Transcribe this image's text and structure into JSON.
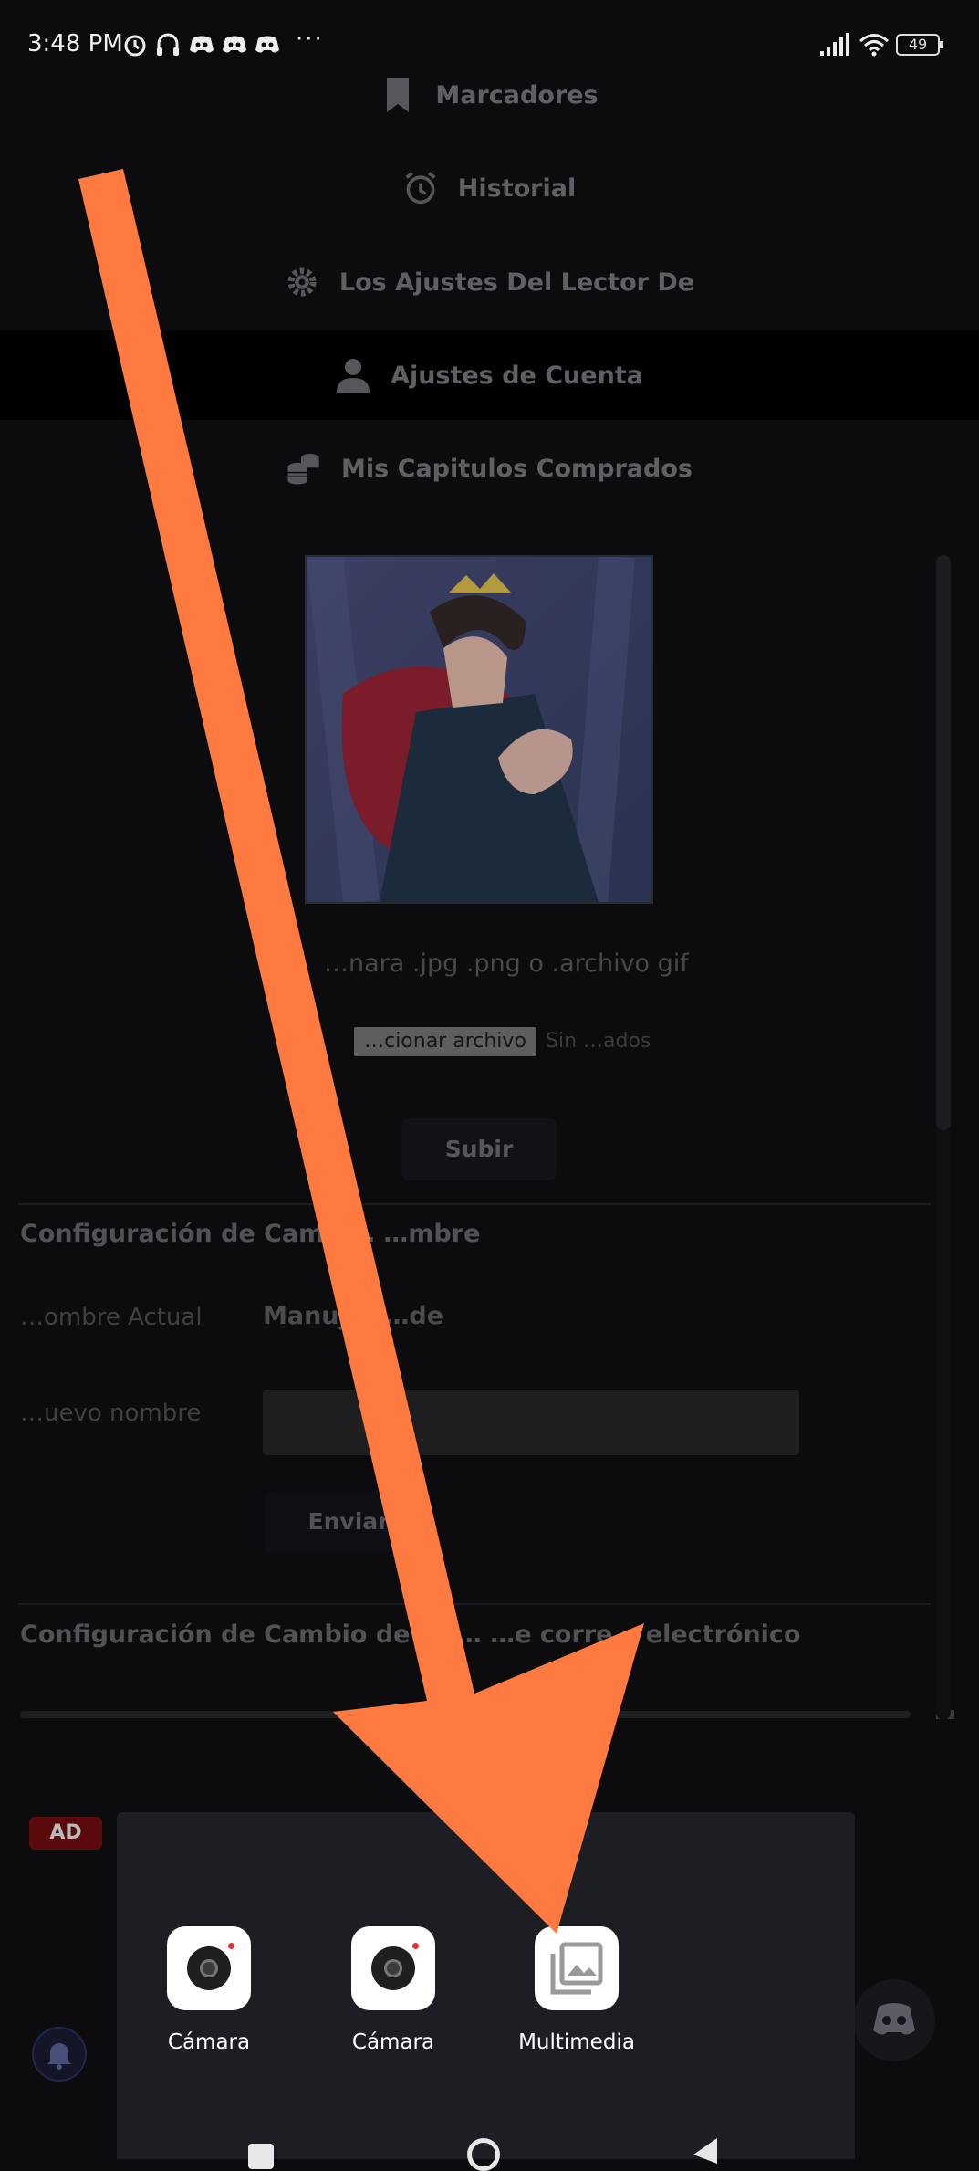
{
  "status_bar": {
    "time": "3:48 PM",
    "battery": "49",
    "more": "···"
  },
  "menu": {
    "items": [
      {
        "label": "Marcadores",
        "icon": "bookmark-icon"
      },
      {
        "label": "Historial",
        "icon": "alarm-clock-icon"
      },
      {
        "label": "Los Ajustes Del Lector De",
        "icon": "gear-icon"
      },
      {
        "label": "Ajustes de Cuenta",
        "icon": "user-icon"
      },
      {
        "label": "Mis Capitulos Comprados",
        "icon": "coins-icon"
      }
    ]
  },
  "avatar_section": {
    "file_hint": "…nara .jpg .png o .archivo gif",
    "file_button": "…cionar archivo",
    "file_status": "Sin …ados",
    "upload_button": "Subir"
  },
  "name_change": {
    "title": "Configuración de Cambi… …mbre",
    "current_label": "…ombre Actual",
    "current_value": "Manu_… …de",
    "new_label": "…uevo nombre",
    "new_value": "",
    "submit_button": "Enviar"
  },
  "email_change": {
    "title": "Configuración de Cambio de dir… …e corre… electrónico"
  },
  "ad": {
    "badge": "AD"
  },
  "chooser": {
    "apps": [
      {
        "label": "Cámara",
        "icon": "camera-app-icon"
      },
      {
        "label": "Cámara",
        "icon": "camera-app-icon"
      },
      {
        "label": "Multimedia",
        "icon": "gallery-icon"
      }
    ]
  },
  "colors": {
    "arrow": "#ff7a41",
    "background": "#0c0c0e",
    "sheet": "#1c1e24"
  }
}
